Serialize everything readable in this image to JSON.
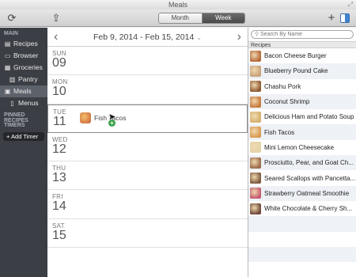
{
  "window": {
    "title": "Meals"
  },
  "toolbar": {
    "view_tabs": [
      {
        "label": "Month",
        "selected": false
      },
      {
        "label": "Week",
        "selected": true
      }
    ],
    "add_label": "+"
  },
  "sidebar": {
    "main_header": "MAIN",
    "items": [
      {
        "label": "Recipes",
        "icon": "book-icon"
      },
      {
        "label": "Browser",
        "icon": "monitor-icon"
      },
      {
        "label": "Groceries",
        "icon": "cart-icon"
      },
      {
        "label": "Pantry",
        "icon": "pantry-icon"
      },
      {
        "label": "Meals",
        "icon": "calendar-icon"
      },
      {
        "label": "Menus",
        "icon": "menu-icon"
      }
    ],
    "pinned_header": "PINNED RECIPES",
    "timers_header": "TIMERS",
    "add_timer_label": "+ Add Timer"
  },
  "calendar": {
    "range": "Feb 9, 2014 - Feb 15, 2014",
    "days": [
      {
        "name": "SUN",
        "num": "09"
      },
      {
        "name": "MON",
        "num": "10"
      },
      {
        "name": "TUE",
        "num": "11"
      },
      {
        "name": "WED",
        "num": "12"
      },
      {
        "name": "THU",
        "num": "13"
      },
      {
        "name": "FRI",
        "num": "14"
      },
      {
        "name": "SAT",
        "num": "15"
      }
    ],
    "event": {
      "label": "Fish Tacos"
    }
  },
  "recipes_panel": {
    "search_placeholder": "Search By Name",
    "header": "Recipes",
    "items": [
      {
        "name": "Bacon Cheese Burger",
        "color": "#b5693a"
      },
      {
        "name": "Blueberry Pound Cake",
        "color": "#c9a37a"
      },
      {
        "name": "Chashu Pork",
        "color": "#8e5a34"
      },
      {
        "name": "Coconut Shrimp",
        "color": "#c87a3c"
      },
      {
        "name": "Delicious Ham and Potato Soup",
        "color": "#d6b271"
      },
      {
        "name": "Fish Tacos",
        "color": "#d99a52"
      },
      {
        "name": "Mini Lemon Cheesecake",
        "color": "#e3d4a8"
      },
      {
        "name": "Prosciutto, Pear, and Goat Ch...",
        "color": "#9b6a4a"
      },
      {
        "name": "Seared Scallops with Pancetta...",
        "color": "#7e5a3e"
      },
      {
        "name": "Strawberry Oatmeal Smoothie",
        "color": "#c45a6e"
      },
      {
        "name": "White Chocolate & Cherry Sh...",
        "color": "#6f4a3a"
      }
    ]
  }
}
